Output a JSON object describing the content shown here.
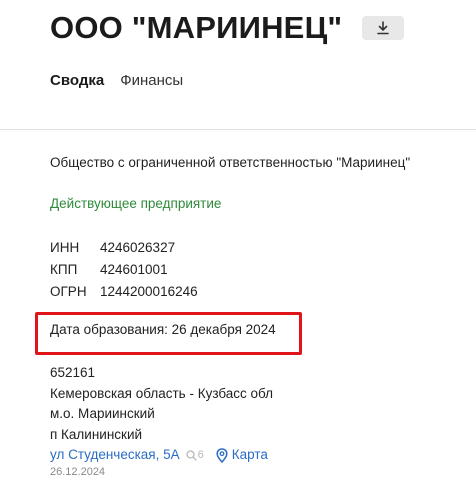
{
  "header": {
    "title": "ООО \"МАРИИНЕЦ\""
  },
  "tabs": [
    {
      "label": "Сводка",
      "active": true
    },
    {
      "label": "Финансы",
      "active": false
    }
  ],
  "company": {
    "full_name": "Общество с ограниченной ответственностью \"Мариинец\"",
    "status": "Действующее предприятие",
    "status_color": "#2e8b3a",
    "codes": [
      {
        "label": "ИНН",
        "value": "4246026327"
      },
      {
        "label": "КПП",
        "value": "424601001"
      },
      {
        "label": "ОГРН",
        "value": "1244200016246"
      }
    ],
    "founded": "Дата образования: 26 декабря 2024",
    "address": {
      "postal_code": "652161",
      "region": "Кемеровская область - Кузбасс обл",
      "district": "м.о. Мариинский",
      "settlement": "п Калининский",
      "street": "ул Студенческая, 5А",
      "search_count": "6",
      "map_label": "Карта",
      "date": "26.12.2024"
    }
  },
  "colors": {
    "link": "#2b6cc4",
    "highlight": "#e0151a"
  },
  "icons": {
    "download": "download-icon",
    "search": "search-icon",
    "map_pin": "map-pin-icon"
  }
}
